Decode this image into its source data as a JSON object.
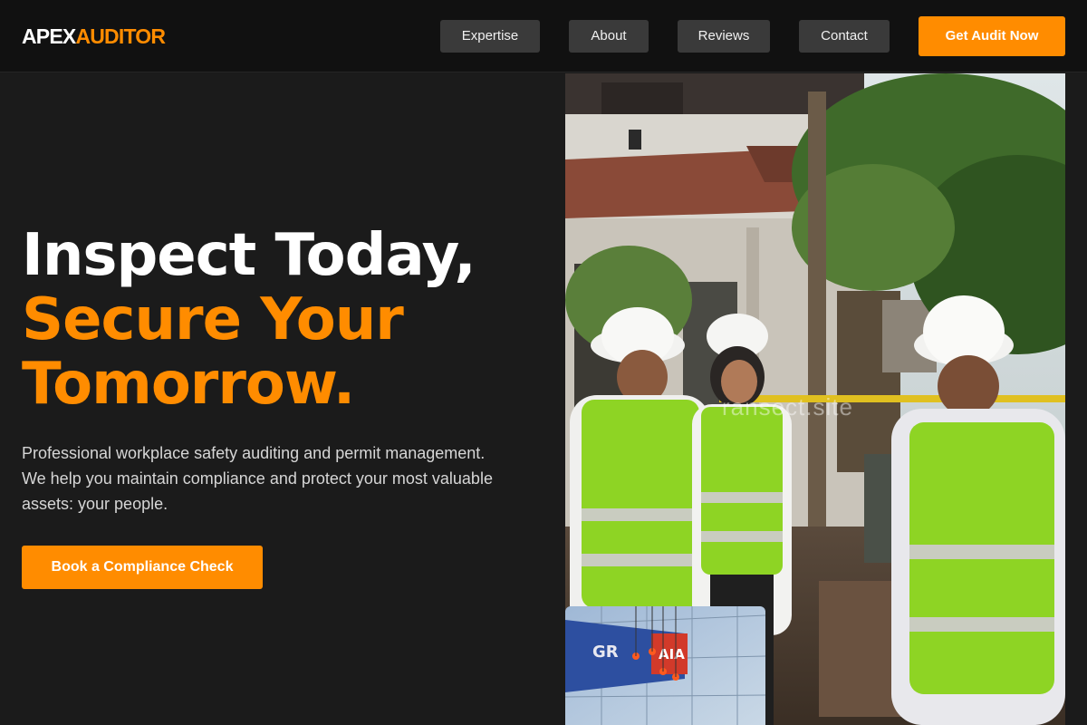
{
  "brand": {
    "logo_part1": "APEX",
    "logo_part2": "AUDITOR",
    "accent_color": "#ff8c00"
  },
  "nav": {
    "items": [
      {
        "label": "Expertise"
      },
      {
        "label": "About"
      },
      {
        "label": "Reviews"
      },
      {
        "label": "Contact"
      }
    ],
    "cta_label": "Get Audit Now"
  },
  "hero": {
    "heading_line1": "Inspect Today,",
    "heading_line2": "Secure Your",
    "heading_line3": "Tomorrow.",
    "description": "Professional workplace safety auditing and permit management. We help you maintain compliance and protect your most valuable assets: your people.",
    "cta_label": "Book a Compliance Check"
  },
  "images": {
    "main_photo_icon": "safety-inspectors-photo",
    "main_photo_watermark": "ransect.site",
    "secondary_photo_icon": "rope-access-workers-photo",
    "secondary_sign_text": "GR",
    "secondary_sign_text2": "AIA"
  }
}
